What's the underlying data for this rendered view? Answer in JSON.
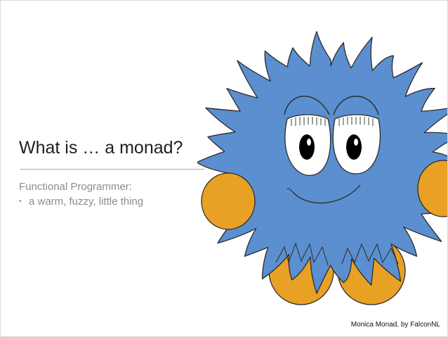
{
  "slide": {
    "title": "What is … a monad?",
    "subheading": "Functional Programmer:",
    "bullets": [
      {
        "mark": "•",
        "text": "a warm, fuzzy, little thing"
      }
    ],
    "credit": "Monica Monad, by FalconNL"
  },
  "illustration": {
    "subject": "monica-monad-monster",
    "colors": {
      "fur": "#5b8fcf",
      "paws": "#e8a124",
      "outline": "#2b2b2b",
      "eye_white": "#ffffff",
      "pupil": "#000000"
    }
  }
}
